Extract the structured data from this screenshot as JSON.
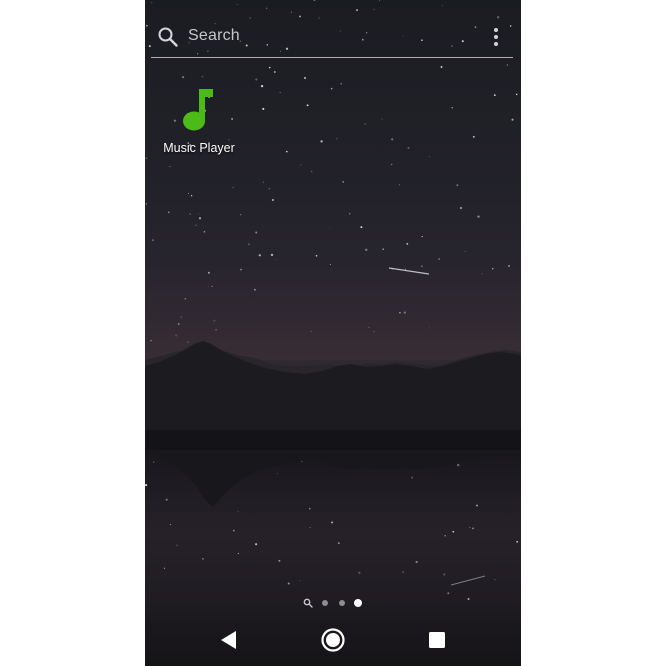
{
  "search": {
    "placeholder": "Search",
    "icon": "search-icon",
    "menu_icon": "overflow-menu-icon"
  },
  "apps": [
    {
      "label": "Music Player",
      "icon": "music-note-icon",
      "icon_color": "#4cbb17"
    }
  ],
  "page_indicator": {
    "pages": 3,
    "current_page": 3,
    "has_search_page": true
  },
  "nav_bar": {
    "back_icon": "back-triangle-icon",
    "home_icon": "home-circle-icon",
    "recents_icon": "recents-square-icon"
  },
  "colors": {
    "accent": "#4cbb17",
    "text": "#ffffff",
    "hint": "#c7c7cb"
  }
}
